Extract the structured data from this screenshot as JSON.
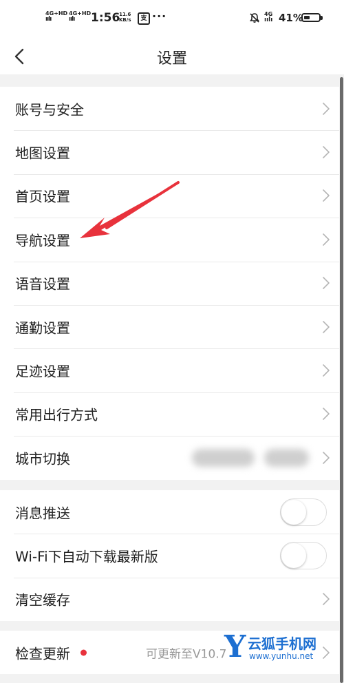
{
  "status_bar": {
    "signal1_label": "4G+HD",
    "signal2_label": "4G+HD",
    "time": "1:56",
    "speed_value": "11.6",
    "speed_unit": "KB/s",
    "app_badge": "支",
    "more_dots": "···",
    "network_label": "4G",
    "battery_percent": "41%",
    "battery_level": 0.41
  },
  "header": {
    "title": "设置",
    "back_icon": "chevron-left-icon"
  },
  "groups": [
    [
      {
        "label": "账号与安全",
        "type": "link"
      },
      {
        "label": "地图设置",
        "type": "link"
      },
      {
        "label": "首页设置",
        "type": "link"
      },
      {
        "label": "导航设置",
        "type": "link"
      },
      {
        "label": "语音设置",
        "type": "link"
      },
      {
        "label": "通勤设置",
        "type": "link"
      },
      {
        "label": "足迹设置",
        "type": "link"
      },
      {
        "label": "常用出行方式",
        "type": "link"
      },
      {
        "label": "城市切换",
        "type": "link",
        "value_blurred": true
      }
    ],
    [
      {
        "label": "消息推送",
        "type": "toggle",
        "on": false
      },
      {
        "label": "Wi-Fi下自动下载最新版",
        "type": "toggle",
        "on": false
      },
      {
        "label": "清空缓存",
        "type": "link"
      }
    ],
    [
      {
        "label": "检查更新",
        "type": "link",
        "badge": true,
        "value": "可更新至V10.7"
      }
    ]
  ],
  "annotation": {
    "arrow_color": "#e8323c",
    "target": "导航设置"
  },
  "watermark": {
    "logo_letter": "Y",
    "site_name": "云狐手机网",
    "url": "www.yunhu.net",
    "color": "#1d6fd1"
  }
}
